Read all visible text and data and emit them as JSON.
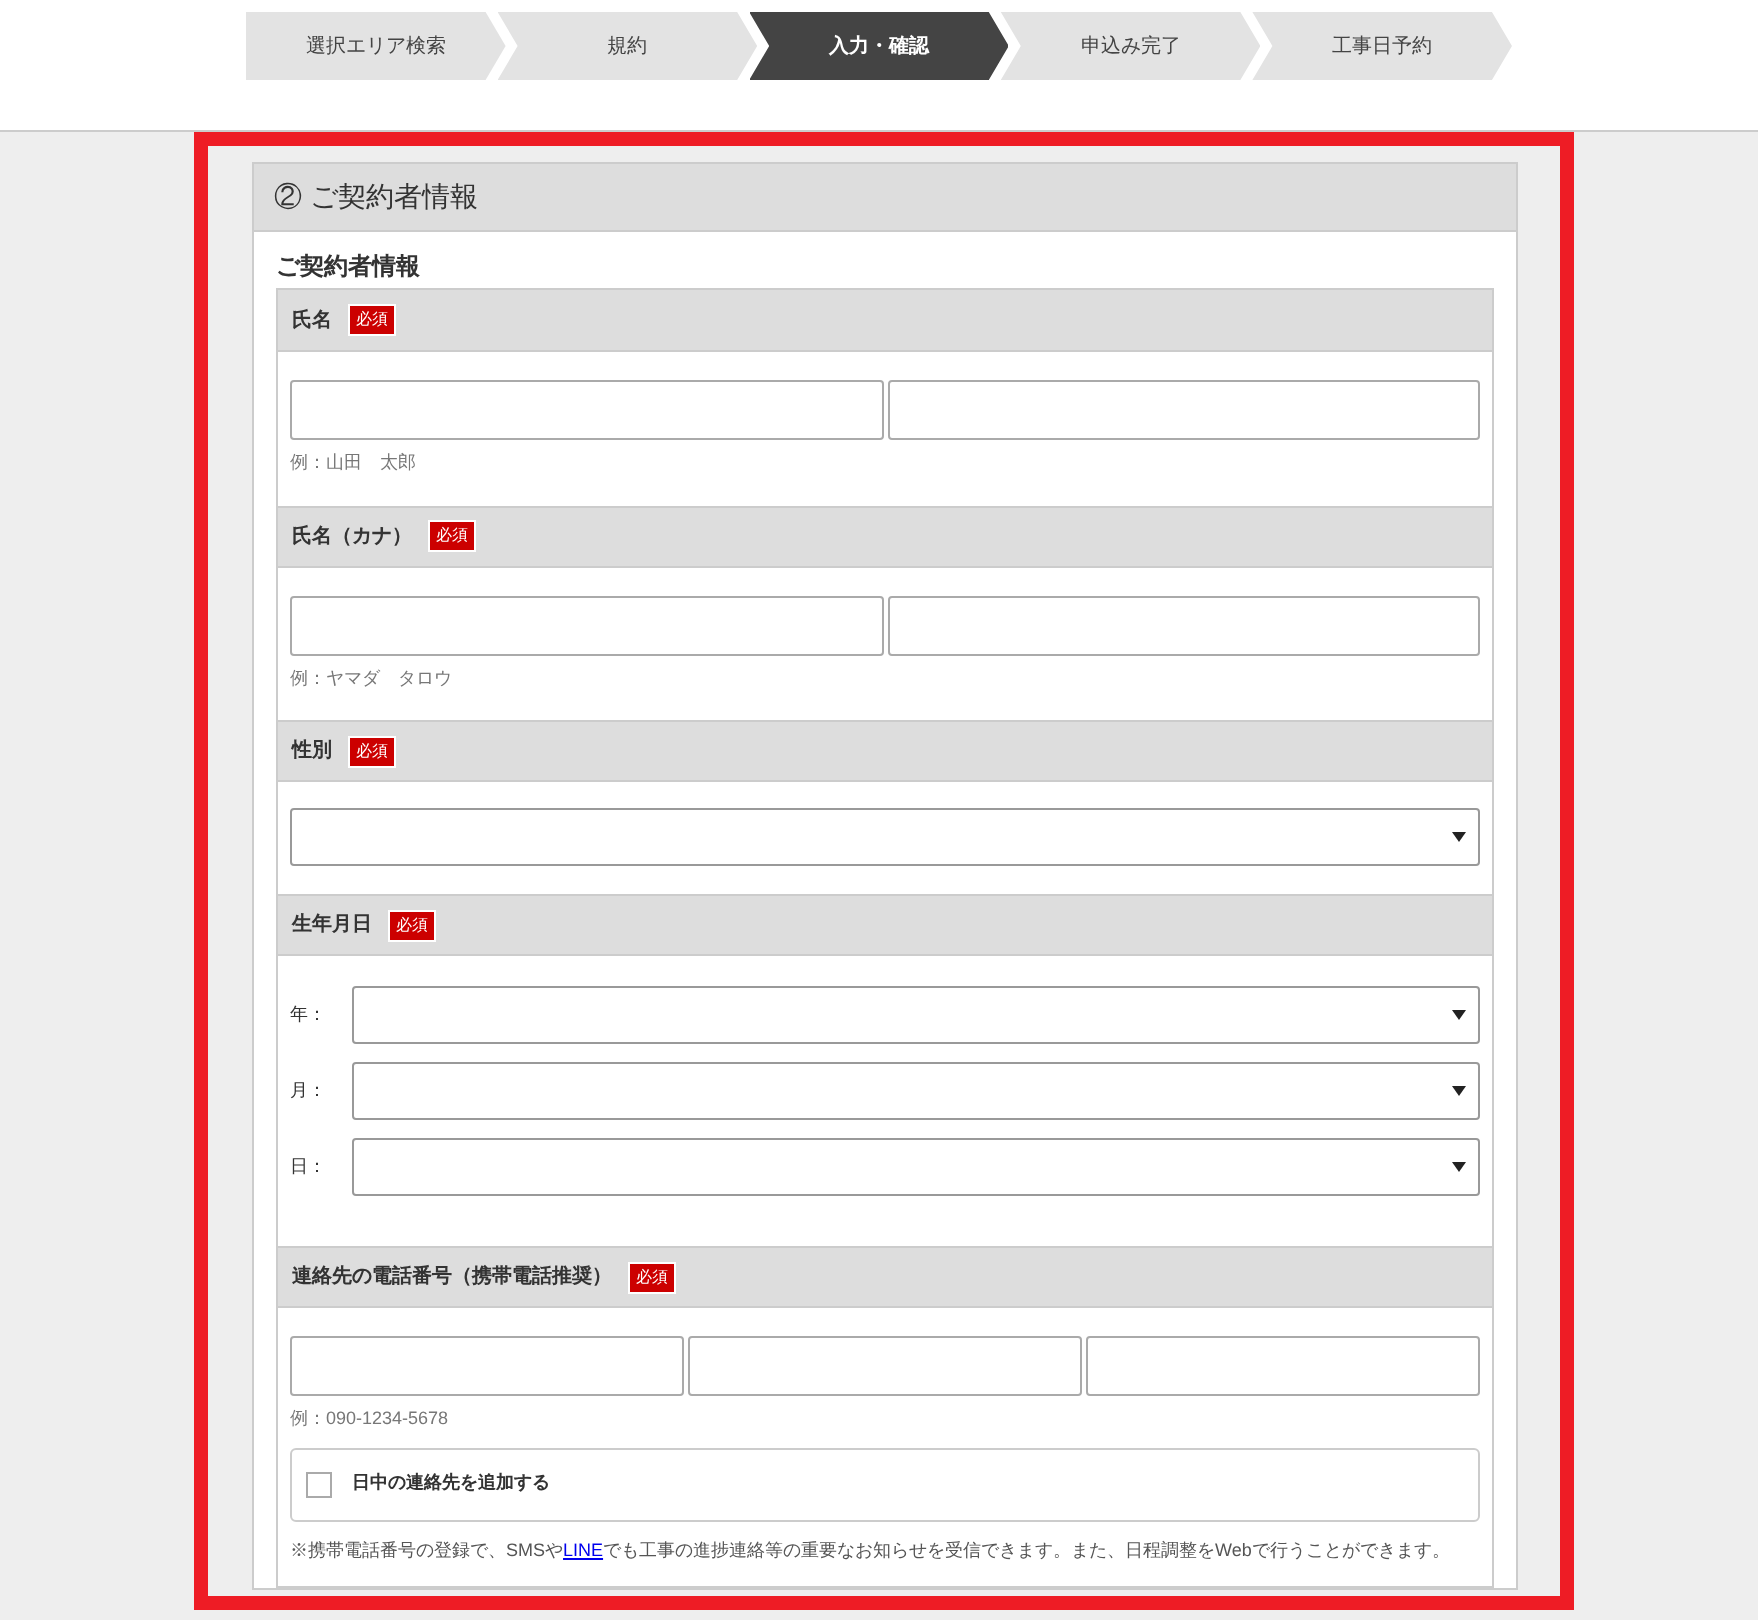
{
  "steps": [
    {
      "label": "選択エリア検索",
      "selected": false
    },
    {
      "label": "規約",
      "selected": false
    },
    {
      "label": "入力・確認",
      "selected": true
    },
    {
      "label": "申込み完了",
      "selected": false
    },
    {
      "label": "工事日予約",
      "selected": false
    }
  ],
  "section_title": "② ご契約者情報",
  "subsection_title": "ご契約者情報",
  "fields": [
    {
      "kind": "pair",
      "label": "氏名",
      "badge": "必須",
      "example": "例：山田　太郎"
    },
    {
      "kind": "pair",
      "label": "氏名（カナ）",
      "badge": "必須",
      "example": "例：ヤマダ　タロウ"
    },
    {
      "kind": "select",
      "label": "性別",
      "badge": "必須"
    },
    {
      "kind": "date",
      "label": "生年月日",
      "badge": "必須",
      "parts": [
        {
          "label": "年："
        },
        {
          "label": "月："
        },
        {
          "label": "日："
        }
      ]
    },
    {
      "kind": "phone",
      "label": "連絡先の電話番号（携帯電話推奨）",
      "badge": "必須",
      "example": "例：090-1234-5678",
      "extra": {
        "label": "日中の連絡先を追加する",
        "checked": false
      },
      "note": {
        "before": "※携帯電話番号の登録で、SMSや",
        "link": "LINE",
        "after": "でも工事の進捗連絡等の重要なお知らせを受信できます。また、日程調整をWebで行うことができます。"
      }
    }
  ]
}
